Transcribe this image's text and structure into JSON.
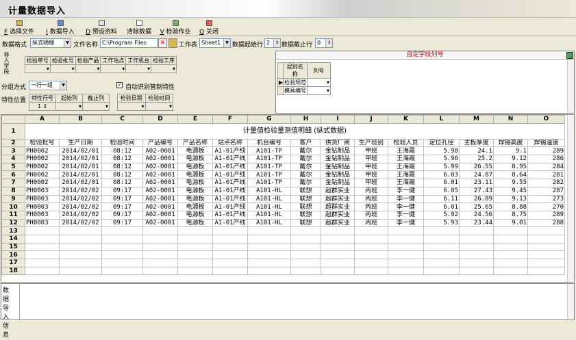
{
  "window": {
    "title": "计量数据导入"
  },
  "toolbar": {
    "items": [
      {
        "key": "F",
        "label": "选择文件"
      },
      {
        "key": "I",
        "label": "数据导入"
      },
      {
        "key": "D",
        "label": "预设资料"
      },
      {
        "key": "",
        "label": "清除数据"
      },
      {
        "key": "V",
        "label": "检验作业"
      },
      {
        "key": "Q",
        "label": "关闭"
      }
    ]
  },
  "options": {
    "format_label": "数据格式",
    "format_value": "纵式明细",
    "file_label": "文件名称",
    "file_value": "C:\\Program Files",
    "sheet_label": "工作表",
    "sheet_value": "Sheet1",
    "start_row_label": "数据起始行",
    "start_row_value": "2",
    "end_row_label": "数据截止行",
    "end_row_value": "0"
  },
  "left_panel": {
    "side_label": "导入字段",
    "field_headers": [
      "检验单号",
      "检验批号",
      "检验产品",
      "工作站点",
      "工作机台",
      "检验工序"
    ],
    "group_label": "分组方式",
    "group_value": "一行一组",
    "auto_detect_label": "自动识别管制特性",
    "auto_detect_checked": true,
    "position_label": "特性位置",
    "position_headers": [
      "特性行号",
      "起始列",
      "截止列"
    ],
    "position_values": [
      "1",
      "",
      ""
    ],
    "date_headers": [
      "检验日期",
      "检验时间"
    ]
  },
  "right_panel": {
    "title": "自定字段列号",
    "headers": [
      "层别名称",
      "列号"
    ],
    "rows": [
      {
        "name": "检验规范",
        "col": ""
      },
      {
        "name": "模具编号",
        "col": ""
      }
    ]
  },
  "grid": {
    "columns": [
      "A",
      "B",
      "C",
      "D",
      "E",
      "F",
      "G",
      "H",
      "I",
      "J",
      "K",
      "L",
      "M",
      "N",
      "O"
    ],
    "row_numbers": [
      "1",
      "2",
      "3",
      "4",
      "5",
      "6",
      "7",
      "8",
      "9",
      "10",
      "11",
      "12",
      "13",
      "14",
      "15",
      "16",
      "17",
      "18"
    ],
    "sheet_title": "计量值检验量测值明细 (纵式数据)",
    "headers": [
      "检验批号",
      "生产日期",
      "检验时间",
      "产品编号",
      "产品名称",
      "站点名称",
      "机台编号",
      "客户",
      "供货厂商",
      "生产班别",
      "检验人员",
      "定位孔径",
      "主板厚度",
      "焊锡高度",
      "焊锡温度"
    ],
    "rows": [
      [
        "PH0002",
        "2014/02/01",
        "08:12",
        "A02-0001",
        "电源板",
        "A1-01产线",
        "A101-TP",
        "戴尔",
        "金钻制品",
        "甲班",
        "王海霞",
        "5.98",
        "24.1",
        "9.1",
        "289"
      ],
      [
        "PH0002",
        "2014/02/01",
        "08:12",
        "A02-0001",
        "电源板",
        "A1-01产线",
        "A101-TP",
        "戴尔",
        "金钻制品",
        "甲班",
        "王海霞",
        "5.96",
        "25.2",
        "9.12",
        "286"
      ],
      [
        "PH0002",
        "2014/02/01",
        "08:12",
        "A02-0001",
        "电源板",
        "A1-01产线",
        "A101-TP",
        "戴尔",
        "金钻制品",
        "甲班",
        "王海霞",
        "5.99",
        "26.55",
        "8.95",
        "284"
      ],
      [
        "PH0002",
        "2014/02/01",
        "08:12",
        "A02-0001",
        "电源板",
        "A1-01产线",
        "A101-TP",
        "戴尔",
        "金钻制品",
        "甲班",
        "王海霞",
        "6.03",
        "24.87",
        "8.64",
        "281"
      ],
      [
        "PH0002",
        "2014/02/01",
        "08:12",
        "A02-0001",
        "电源板",
        "A1-01产线",
        "A101-TP",
        "戴尔",
        "金钻制品",
        "甲班",
        "王海霞",
        "6.01",
        "23.11",
        "9.55",
        "282"
      ],
      [
        "PH0003",
        "2014/02/02",
        "09:17",
        "A02-0001",
        "电源板",
        "A1-01产线",
        "A101-HL",
        "联想",
        "超群实业",
        "丙班",
        "李一健",
        "6.05",
        "27.43",
        "9.45",
        "287"
      ],
      [
        "PH0003",
        "2014/02/02",
        "09:17",
        "A02-0001",
        "电源板",
        "A1-01产线",
        "A101-HL",
        "联想",
        "超群实业",
        "丙班",
        "李一健",
        "6.11",
        "26.89",
        "9.13",
        "273"
      ],
      [
        "PH0003",
        "2014/02/02",
        "09:17",
        "A02-0001",
        "电源板",
        "A1-01产线",
        "A101-HL",
        "联想",
        "超群实业",
        "丙班",
        "李一健",
        "6.01",
        "25.65",
        "8.88",
        "270"
      ],
      [
        "PH0003",
        "2014/02/02",
        "09:17",
        "A02-0001",
        "电源板",
        "A1-01产线",
        "A101-HL",
        "联想",
        "超群实业",
        "丙班",
        "李一健",
        "5.92",
        "24.56",
        "8.75",
        "289"
      ],
      [
        "PH0003",
        "2014/02/02",
        "09:17",
        "A02-0001",
        "电源板",
        "A1-01产线",
        "A101-HL",
        "联想",
        "超群实业",
        "丙班",
        "李一健",
        "5.93",
        "23.44",
        "9.01",
        "288"
      ]
    ]
  },
  "info_panel": {
    "label": "数据导入信息"
  }
}
